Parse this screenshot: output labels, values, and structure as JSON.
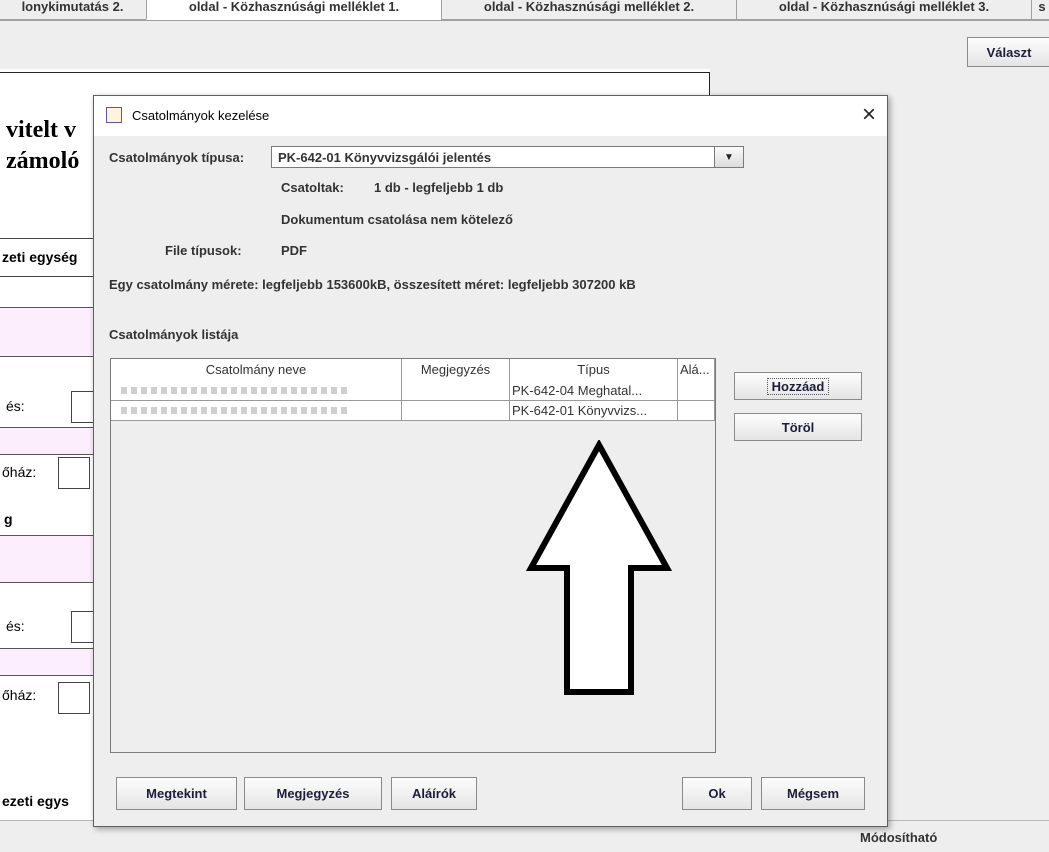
{
  "background": {
    "tabs": [
      {
        "label": "lonykimutatás 2."
      },
      {
        "label": "oldal - Közhasznúsági melléklet 1.",
        "active": true
      },
      {
        "label": "oldal - Közhasznúsági melléklet 2."
      },
      {
        "label": "oldal - Közhasznúsági melléklet 3."
      },
      {
        "label": "s"
      }
    ],
    "valaszt_label": "Választ",
    "heading_line1": "vitelt v",
    "heading_line2": "zámoló",
    "label_egyseg": "zeti egység",
    "label_es1": "és:",
    "label_ohaz1": "őház:",
    "label_g": "g",
    "label_es2": "és:",
    "label_ohaz2": "őház:",
    "label_egys_bottom": "ezeti egys",
    "status_text": "Módosítható"
  },
  "dialog": {
    "title": "Csatolmányok kezelése",
    "type_label": "Csatolmányok típusa:",
    "type_value": "PK-642-01 Könyvvizsgálói jelentés",
    "attached_label": "Csatoltak:",
    "attached_value": "1 db - legfeljebb 1 db",
    "optional_note": "Dokumentum csatolása nem kötelező",
    "filetype_label": "File típusok:",
    "filetype_value": "PDF",
    "size_note": "Egy csatolmány mérete: legfeljebb 153600kB, összesített méret: legfeljebb 307200 kB",
    "list_title": "Csatolmányok listája",
    "table": {
      "headers": [
        "Csatolmány neve",
        "Megjegyzés",
        "Típus",
        "Alá..."
      ],
      "rows": [
        {
          "name": "",
          "comment": "",
          "type": "PK-642-04 Meghatal...",
          "signers": ""
        },
        {
          "name": "",
          "comment": "",
          "type": "PK-642-01 Könyvvizs...",
          "signers": ""
        }
      ]
    },
    "buttons": {
      "add": "Hozzáad",
      "delete": "Töröl",
      "view": "Megtekint",
      "comment": "Megjegyzés",
      "signers": "Aláírók",
      "ok": "Ok",
      "cancel": "Mégsem"
    }
  }
}
